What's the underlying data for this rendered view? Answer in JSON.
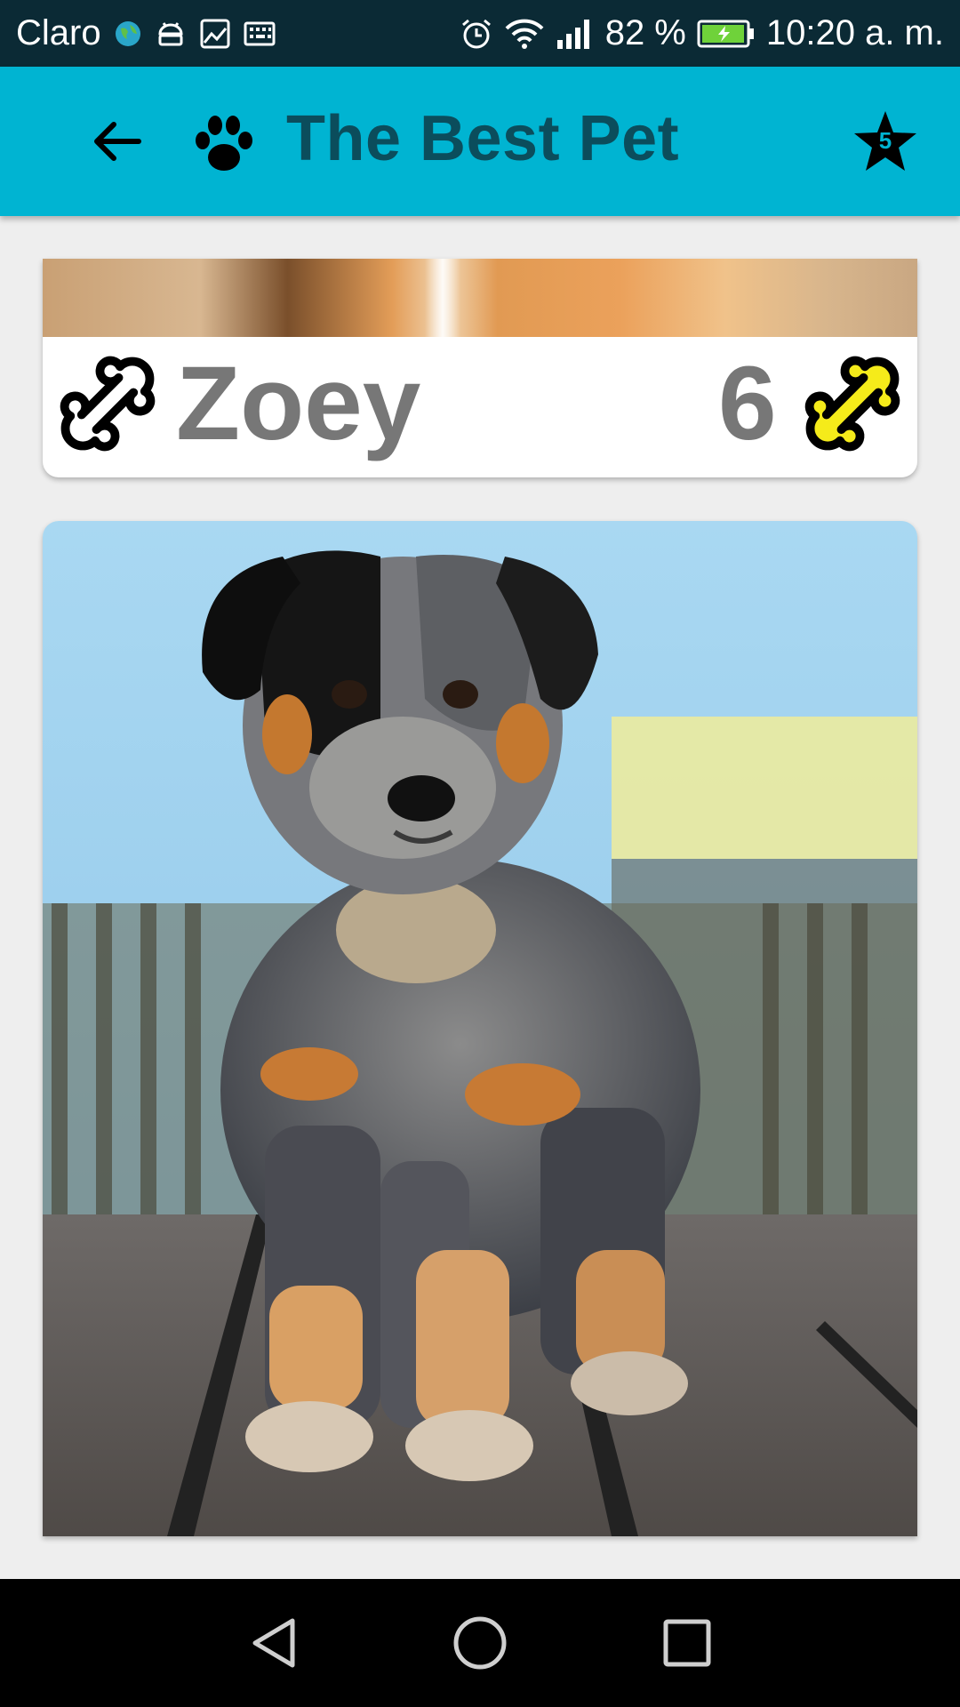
{
  "status_bar": {
    "carrier": "Claro",
    "battery": "82 %",
    "time": "10:20 a. m.",
    "icons": [
      "globe-icon",
      "android-icon",
      "image-icon",
      "keyboard-icon",
      "alarm-icon",
      "wifi-icon",
      "signal-icon",
      "battery-charging-icon"
    ]
  },
  "app_bar": {
    "title": "The Best Pet",
    "back_icon": "arrow-left-icon",
    "logo_icon": "paw-icon",
    "favorites_count": "5",
    "favorites_icon": "star-icon"
  },
  "pet_card": {
    "name": "Zoey",
    "likes": "6",
    "left_icon": "bone-outline-icon",
    "like_icon": "bone-yellow-icon"
  },
  "photo_card": {
    "subject": "puppy-photo"
  },
  "nav_bar": {
    "buttons": [
      "back-triangle-icon",
      "home-circle-icon",
      "recents-square-icon"
    ]
  },
  "colors": {
    "status_bar": "#0b2a35",
    "app_bar": "#00b4d2",
    "title": "#0b4d5c",
    "pet_text": "#777777",
    "bone_fill": "#f5eb1a",
    "background": "#eeeeee"
  }
}
